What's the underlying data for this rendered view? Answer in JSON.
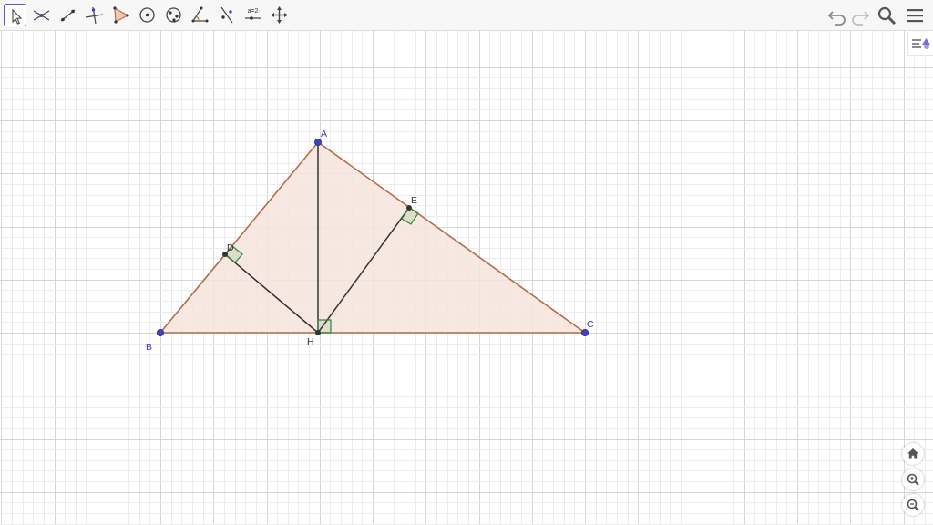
{
  "toolbar": {
    "tools": [
      {
        "name": "move-tool",
        "icon": "arrow-pointer-icon",
        "selected": true
      },
      {
        "name": "point-tool",
        "icon": "intersect-point-icon",
        "selected": false
      },
      {
        "name": "line-tool",
        "icon": "line-icon",
        "selected": false
      },
      {
        "name": "perpendicular-tool",
        "icon": "perpendicular-icon",
        "selected": false
      },
      {
        "name": "polygon-tool",
        "icon": "polygon-icon",
        "selected": false
      },
      {
        "name": "circle-tool",
        "icon": "circle-center-icon",
        "selected": false
      },
      {
        "name": "conic-tool",
        "icon": "ellipse-icon",
        "selected": false
      },
      {
        "name": "angle-tool",
        "icon": "angle-icon",
        "selected": false
      },
      {
        "name": "reflect-tool",
        "icon": "reflect-icon",
        "selected": false
      },
      {
        "name": "slider-tool",
        "icon": "slider-icon",
        "label": "a=2",
        "selected": false
      },
      {
        "name": "move-view-tool",
        "icon": "move-graphics-icon",
        "selected": false
      }
    ],
    "right_buttons": [
      "undo-icon",
      "redo-icon",
      "search-icon",
      "menu-icon"
    ]
  },
  "construction": {
    "points": {
      "A": {
        "label": "A"
      },
      "B": {
        "label": "B"
      },
      "C": {
        "label": "C"
      },
      "H": {
        "label": "H"
      },
      "D": {
        "label": "D"
      },
      "E": {
        "label": "E"
      }
    }
  },
  "colors": {
    "triangle_fill": "#f6e4dc",
    "triangle_stroke": "#b46d4a",
    "segment": "#333333",
    "free_point": "#4040c0",
    "dependent_point": "#333333",
    "right_angle": "#2e8a2e",
    "grid_minor": "#ececec",
    "grid_major": "#d6d6d6",
    "label_free": "#3838b0",
    "accent": "#6557d2"
  },
  "side_buttons": [
    "home-icon",
    "zoom-in-icon",
    "zoom-out-icon"
  ],
  "style_bar": "style-bar-toggle-icon"
}
